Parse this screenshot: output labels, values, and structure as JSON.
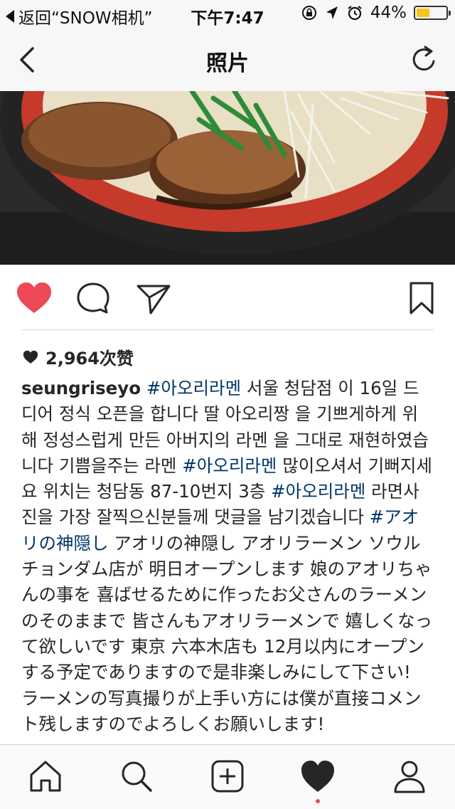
{
  "status_bar": {
    "back_label": "返回“SNOW相机”",
    "time": "下午7:47",
    "battery_percent_label": "44%",
    "battery_level": 0.44,
    "battery_color": "#f4c51c"
  },
  "nav": {
    "title": "照片",
    "back_icon": "chevron-left-icon",
    "refresh_icon": "refresh-icon"
  },
  "post": {
    "liked": true,
    "heart_color": "#ed4956",
    "likes_text": "2,964次赞",
    "caption": {
      "username": "seungriseyo",
      "tag1": "#아오리라멘",
      "text1": " 서울 청담점 이 16일 드디어 정식 오픈을 합니다 딸 아오리짱 을 기쁘게하게 위해 정성스럽게 만든 아버지의 라멘 을 그대로 재현하였습니다 기쁨을주는 라멘 ",
      "tag2": "#아오리라멘",
      "text2": " 많이오셔서 기뻐지세요 위치는  청담동 87-10번지 3층 ",
      "tag3": "#아오리라멘",
      "text3": " 라면사진을 가장 잘찍으신분들께 댓글을 남기겠습니다 ",
      "tag4": "#アオリの神隠し",
      "text4": " アオリの神隠し アオリラーメン ソウルチョンダム店が 明日オープンします 娘のアオリちゃんの事を 喜ばせるために作ったお父さんのラーメンのそのままで 皆さんもアオリラーメンで 嬉しくなって欲しいです 東京 六本木店も 12月以内にオープンする予定でありますので是非楽しみにして下さい!  ラーメンの写真撮りが上手い方には僕が直接コメント残しますのでよろしくお願いします!"
    },
    "hashtag_color": "#003569"
  },
  "tab_bar": {
    "items": [
      "home-icon",
      "search-icon",
      "new-post-icon",
      "activity-heart-icon",
      "profile-icon"
    ],
    "active": "activity-heart-icon",
    "notification_dot_color": "#ed4956"
  }
}
